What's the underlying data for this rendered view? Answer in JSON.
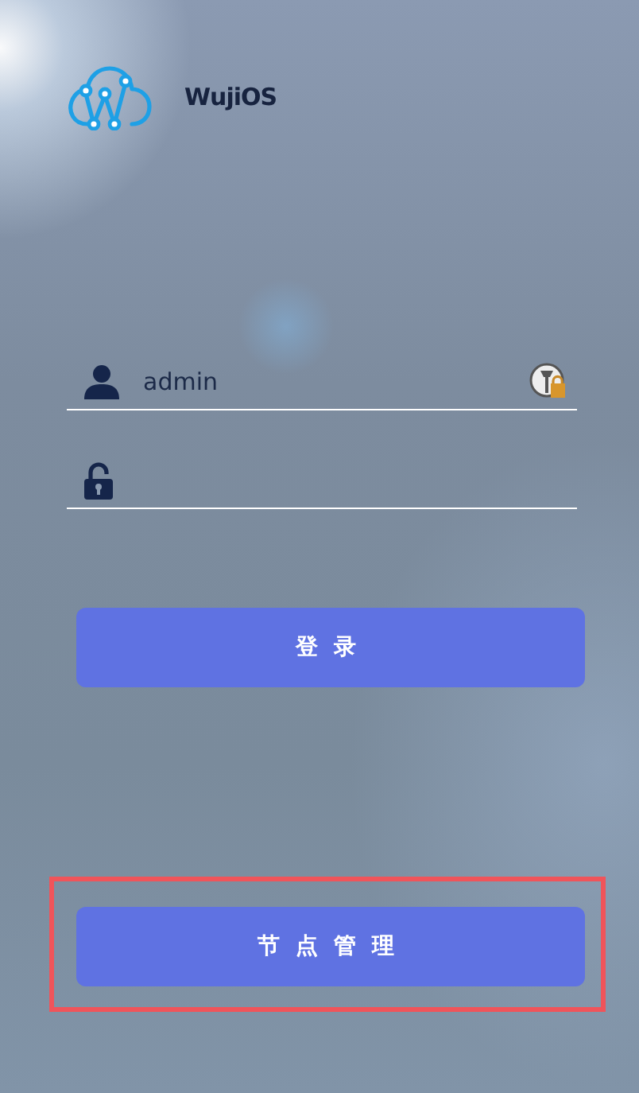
{
  "brand": {
    "name": "WujiOS"
  },
  "fields": [
    {
      "kind": "text",
      "value": "admin"
    },
    {
      "kind": "password"
    }
  ],
  "buttons": [
    {
      "label": "登录",
      "highlighted": false
    },
    {
      "label": "节点管理",
      "highlighted": true
    }
  ]
}
